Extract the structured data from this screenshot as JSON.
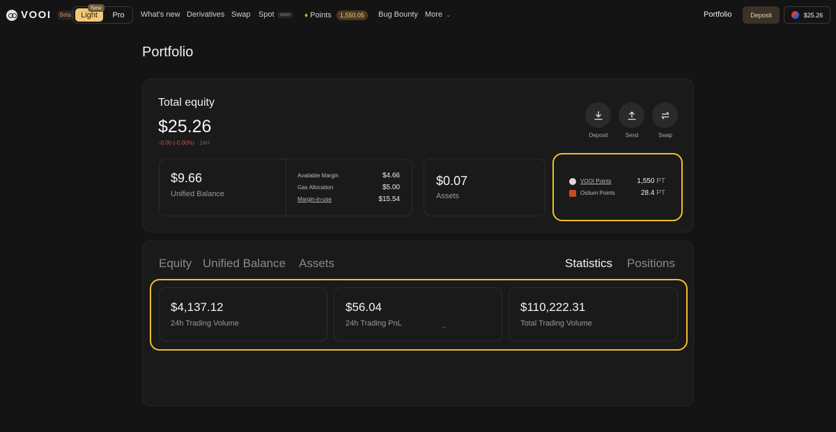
{
  "nav": {
    "brand": "VOOI",
    "beta": "Beta",
    "new_badge": "New",
    "mode_light": "Light",
    "mode_pro": "Pro",
    "links": {
      "whats_new": "What's new",
      "derivatives": "Derivatives",
      "swap": "Swap",
      "spot": "Spot",
      "spot_soon": "soon",
      "points": "Points",
      "points_value": "1,550.05",
      "bug_bounty": "Bug Bounty",
      "more": "More"
    },
    "portfolio": "Portfolio",
    "deposit": "Deposit",
    "wallet_balance": "$25.26"
  },
  "page": {
    "title": "Portfolio"
  },
  "equity": {
    "label": "Total equity",
    "value": "$25.26",
    "change": "-0.00 (-0.00%)",
    "period": "24H",
    "actions": {
      "deposit": "Deposit",
      "send": "Send",
      "swap": "Swap"
    }
  },
  "unified": {
    "value": "$9.66",
    "label": "Unified Balance",
    "rows": {
      "available_margin_label": "Available Margin",
      "available_margin_value": "$4.66",
      "gas_allocation_label": "Gas Allocation",
      "gas_allocation_value": "$5.00",
      "margin_in_use_label": "Margin-in-use",
      "margin_in_use_value": "$15.54"
    }
  },
  "assets": {
    "value": "$0.07",
    "label": "Assets"
  },
  "points": {
    "vooi_label": "VOOI Points",
    "vooi_value": "1,550",
    "ostium_label": "Ostium Points",
    "ostium_value": "28.4",
    "unit": "PT"
  },
  "tabs": {
    "equity": "Equity",
    "unified_balance": "Unified Balance",
    "assets": "Assets",
    "statistics": "Statistics",
    "positions": "Positions"
  },
  "stats": {
    "volume_24h_value": "$4,137.12",
    "volume_24h_label": "24h Trading Volume",
    "pnl_24h_value": "$56.04",
    "pnl_24h_label": "24h Trading PnL",
    "pnl_dash": "--",
    "total_volume_value": "$110,222.31",
    "total_volume_label": "Total Trading Volume"
  },
  "colors": {
    "accent": "#f2c878",
    "highlight": "#f2c030",
    "negative": "#d05050"
  }
}
